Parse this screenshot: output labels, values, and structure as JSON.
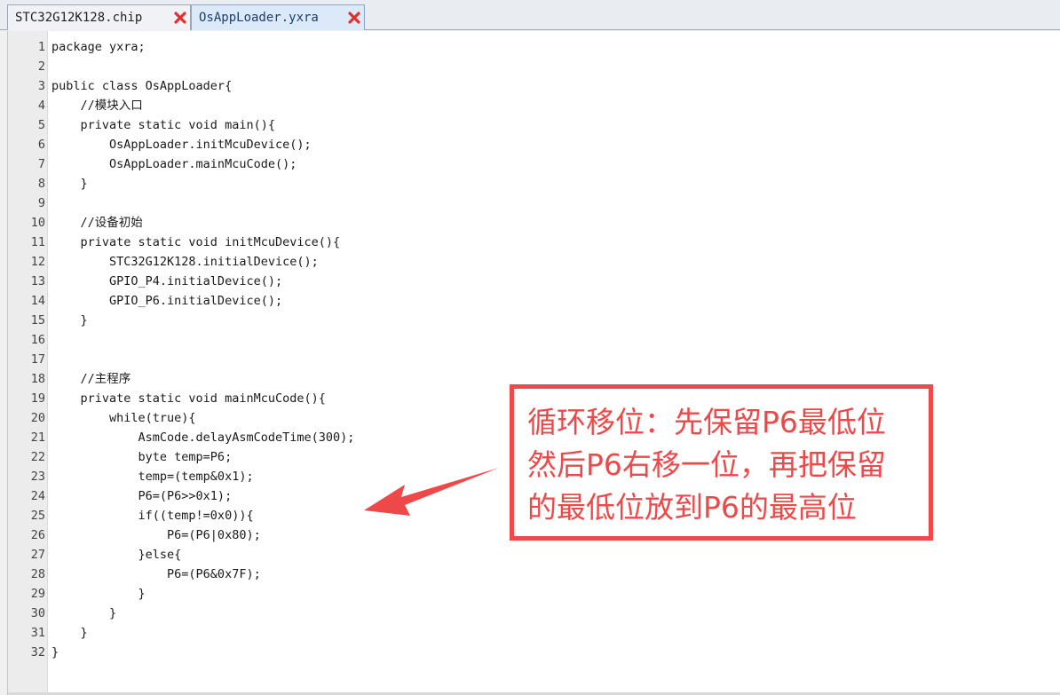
{
  "tabs": [
    {
      "label": "STC32G12K128.chip",
      "active": false
    },
    {
      "label": "OsAppLoader.yxra",
      "active": true
    }
  ],
  "code_lines": [
    {
      "num": "1",
      "text": "package yxra;"
    },
    {
      "num": "2",
      "text": ""
    },
    {
      "num": "3",
      "text": "public class OsAppLoader{"
    },
    {
      "num": "4",
      "text": "    //模块入口"
    },
    {
      "num": "5",
      "text": "    private static void main(){"
    },
    {
      "num": "6",
      "text": "        OsAppLoader.initMcuDevice();"
    },
    {
      "num": "7",
      "text": "        OsAppLoader.mainMcuCode();"
    },
    {
      "num": "8",
      "text": "    }"
    },
    {
      "num": "9",
      "text": ""
    },
    {
      "num": "10",
      "text": "    //设备初始"
    },
    {
      "num": "11",
      "text": "    private static void initMcuDevice(){"
    },
    {
      "num": "12",
      "text": "        STC32G12K128.initialDevice();"
    },
    {
      "num": "13",
      "text": "        GPIO_P4.initialDevice();"
    },
    {
      "num": "14",
      "text": "        GPIO_P6.initialDevice();"
    },
    {
      "num": "15",
      "text": "    }"
    },
    {
      "num": "16",
      "text": ""
    },
    {
      "num": "17",
      "text": ""
    },
    {
      "num": "18",
      "text": "    //主程序"
    },
    {
      "num": "19",
      "text": "    private static void mainMcuCode(){"
    },
    {
      "num": "20",
      "text": "        while(true){"
    },
    {
      "num": "21",
      "text": "            AsmCode.delayAsmCodeTime(300);"
    },
    {
      "num": "22",
      "text": "            byte temp=P6;"
    },
    {
      "num": "23",
      "text": "            temp=(temp&0x1);"
    },
    {
      "num": "24",
      "text": "            P6=(P6>>0x1);"
    },
    {
      "num": "25",
      "text": "            if((temp!=0x0)){"
    },
    {
      "num": "26",
      "text": "                P6=(P6|0x80);"
    },
    {
      "num": "27",
      "text": "            }else{"
    },
    {
      "num": "28",
      "text": "                P6=(P6&0x7F);"
    },
    {
      "num": "29",
      "text": "            }"
    },
    {
      "num": "30",
      "text": "        }"
    },
    {
      "num": "31",
      "text": "    }"
    },
    {
      "num": "32",
      "text": "}"
    }
  ],
  "annotation": {
    "lines": [
      "循环移位：先保留P6最低位",
      "然后P6右移一位，再把保留",
      "的最低位放到P6的最高位"
    ],
    "color": "#ef4848"
  },
  "icons": {
    "tab_close": "close-x-icon",
    "arrow": "arrow-left-icon"
  }
}
